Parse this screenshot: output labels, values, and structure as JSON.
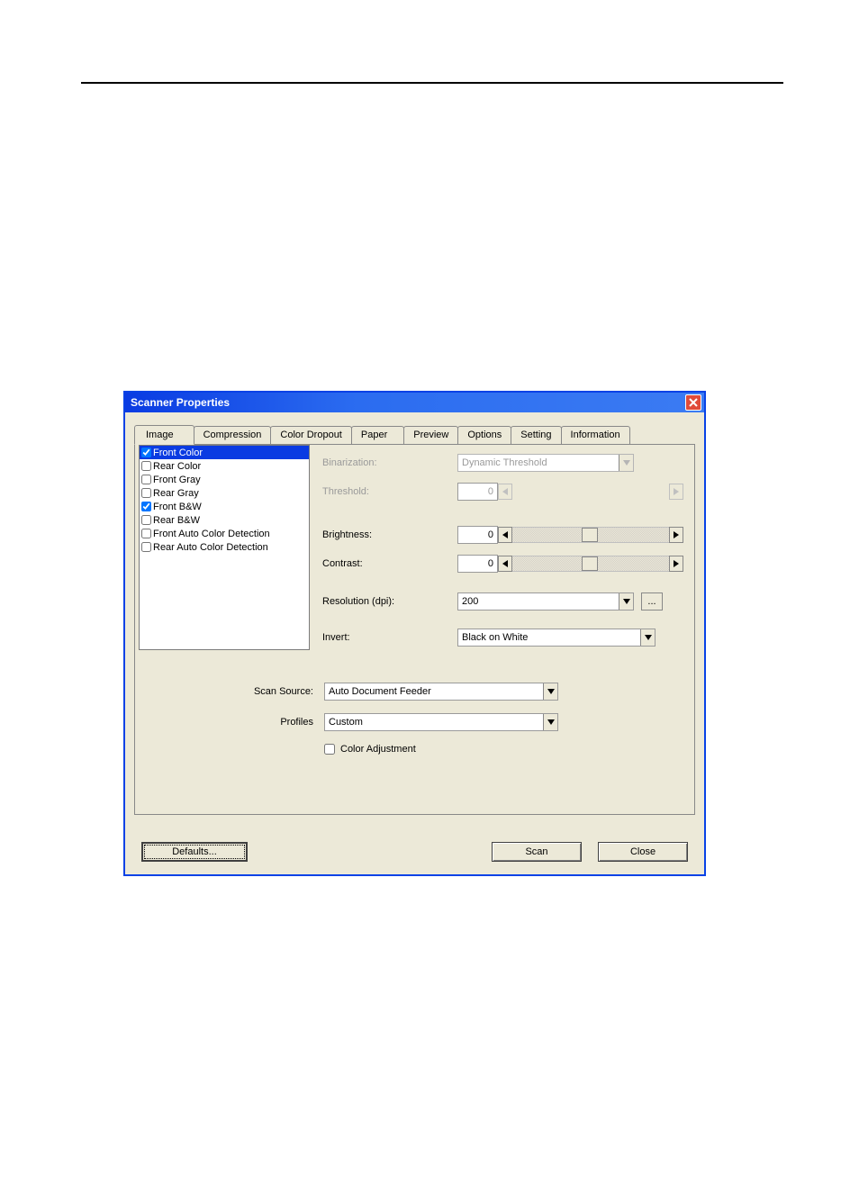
{
  "titlebar": {
    "title": "Scanner Properties"
  },
  "tabs": {
    "image": "Image",
    "compression": "Compression",
    "colordropout": "Color Dropout",
    "paper": "Paper",
    "preview": "Preview",
    "options": "Options",
    "setting": "Setting",
    "information": "Information"
  },
  "imagelist": {
    "frontcolor": "Front Color",
    "rearcolor": "Rear Color",
    "frontgray": "Front Gray",
    "reargray": "Rear Gray",
    "frontbw": "Front B&W",
    "rearbw": "Rear B&W",
    "frontauto": "Front Auto Color Detection",
    "rearauto": "Rear Auto Color Detection"
  },
  "labels": {
    "binarization": "Binarization:",
    "threshold": "Threshold:",
    "brightness": "Brightness:",
    "contrast": "Contrast:",
    "resolution": "Resolution (dpi):",
    "invert": "Invert:",
    "scansource": "Scan Source:",
    "profiles": "Profiles",
    "coloradjust": "Color Adjustment"
  },
  "values": {
    "binarization": "Dynamic Threshold",
    "threshold": "0",
    "brightness": "0",
    "contrast": "0",
    "resolution": "200",
    "invert": "Black on White",
    "scansource": "Auto Document Feeder",
    "profiles": "Custom",
    "more": "..."
  },
  "buttons": {
    "defaults": "Defaults...",
    "scan": "Scan",
    "close": "Close"
  }
}
